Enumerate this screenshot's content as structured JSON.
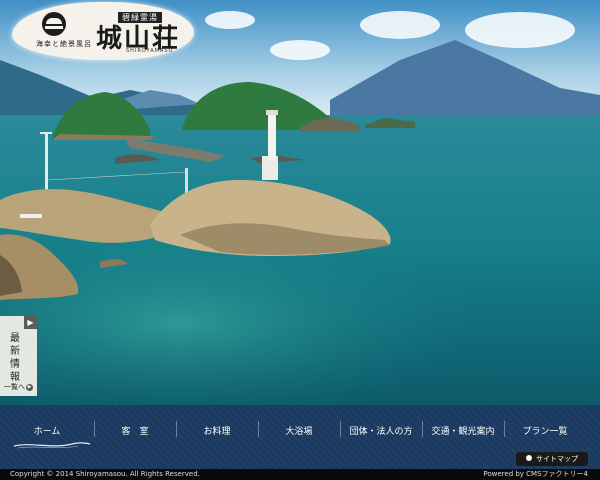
{
  "logo": {
    "badge": "碧緑霊湯",
    "main": "城山荘",
    "sub": "海幸と絶景風呂",
    "roman": "SHIROYAMASO"
  },
  "news": {
    "title": "最新情報",
    "list_link": "一覧へ"
  },
  "nav": {
    "items": [
      {
        "label": "ホーム"
      },
      {
        "label": "客　室"
      },
      {
        "label": "お料理"
      },
      {
        "label": "大浴場"
      },
      {
        "label": "団体・法人の方"
      },
      {
        "label": "交通・観光案内"
      },
      {
        "label": "プラン一覧"
      }
    ]
  },
  "sitemap": {
    "label": "サイトマップ"
  },
  "footer": {
    "copyright": "Copyright © 2014 Shiroyamasou. All Rights Reserved.",
    "powered": "Powered by CMSファクトリー4"
  },
  "colors": {
    "nav_bg": "#1b3a61",
    "sea": "#167e84",
    "sky": "#cfe3ef"
  }
}
